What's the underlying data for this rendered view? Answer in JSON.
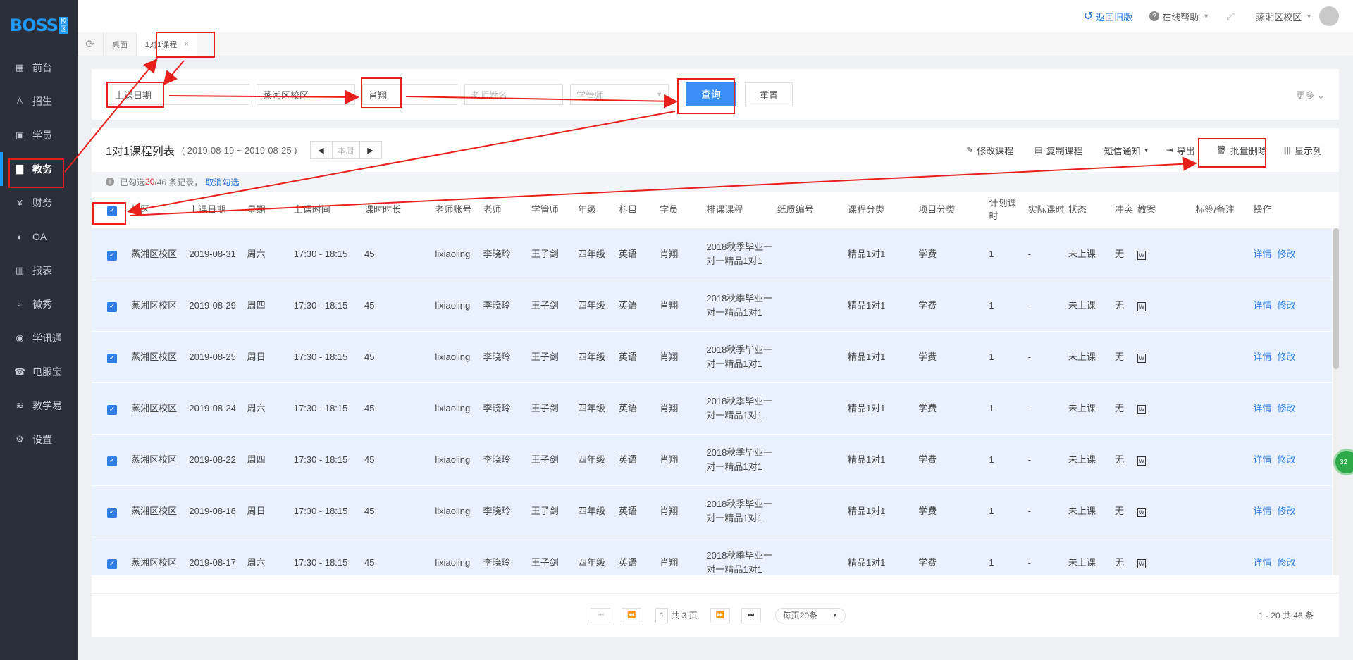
{
  "logo": {
    "text": "BOSS",
    "badge": "校区"
  },
  "sidebar": {
    "items": [
      {
        "label": "前台",
        "icon": "calendar-icon"
      },
      {
        "label": "招生",
        "icon": "user-plus-icon"
      },
      {
        "label": "学员",
        "icon": "student-icon"
      },
      {
        "label": "教务",
        "icon": "book-icon",
        "active": true
      },
      {
        "label": "财务",
        "icon": "yen-icon"
      },
      {
        "label": "OA",
        "icon": "toggle-icon"
      },
      {
        "label": "报表",
        "icon": "bar-chart-icon"
      },
      {
        "label": "微秀",
        "icon": "wave-icon"
      },
      {
        "label": "学讯通",
        "icon": "location-icon"
      },
      {
        "label": "电服宝",
        "icon": "phone-icon"
      },
      {
        "label": "教学易",
        "icon": "teach-icon"
      },
      {
        "label": "设置",
        "icon": "gear-icon"
      }
    ]
  },
  "topbar": {
    "back_old": "返回旧版",
    "help": "在线帮助",
    "campus": "蒸湘区校区"
  },
  "tabs": {
    "home": "桌面",
    "current": "1对1课程",
    "close": "×"
  },
  "filter": {
    "date_placeholder": "上课日期",
    "campus": "蒸湘区校区",
    "student": "肖翔",
    "teacher_placeholder": "老师姓名",
    "manager_placeholder": "学管师",
    "query": "查询",
    "reset": "重置",
    "more": "更多"
  },
  "list": {
    "title": "1对1课程列表",
    "date_range": "( 2019-08-19 ~ 2019-08-25 )",
    "this_week": "本周",
    "tools": {
      "edit": "修改课程",
      "copy": "复制课程",
      "sms": "短信通知",
      "export": "导出",
      "batch_delete": "批量删除",
      "columns": "显示列"
    },
    "info": {
      "prefix": "已勾选 ",
      "selected": "20",
      "suffix": "/46 条记录，",
      "cancel": "取消勾选"
    }
  },
  "table": {
    "headers": [
      "校区",
      "上课日期",
      "星期",
      "上课时间",
      "课时时长",
      "老师账号",
      "老师",
      "学管师",
      "年级",
      "科目",
      "学员",
      "排课课程",
      "纸质编号",
      "课程分类",
      "项目分类",
      "计划课时",
      "实际课时",
      "状态",
      "冲突",
      "教案",
      "标签/备注",
      "操作"
    ],
    "rows": [
      {
        "campus": "蒸湘区校区",
        "date": "2019-08-31",
        "weekday": "周六",
        "time": "17:30 - 18:15",
        "duration": "45",
        "account": "lixiaoling",
        "teacher": "李晓玲",
        "manager": "王子剑",
        "grade": "四年级",
        "subject": "英语",
        "student": "肖翔",
        "course": "2018秋季毕业一对一精品1对1",
        "paper": "",
        "category": "精品1对1",
        "project": "学费",
        "planned": "1",
        "actual": "-",
        "status": "未上课",
        "conflict": "无"
      },
      {
        "campus": "蒸湘区校区",
        "date": "2019-08-29",
        "weekday": "周四",
        "time": "17:30 - 18:15",
        "duration": "45",
        "account": "lixiaoling",
        "teacher": "李晓玲",
        "manager": "王子剑",
        "grade": "四年级",
        "subject": "英语",
        "student": "肖翔",
        "course": "2018秋季毕业一对一精品1对1",
        "paper": "",
        "category": "精品1对1",
        "project": "学费",
        "planned": "1",
        "actual": "-",
        "status": "未上课",
        "conflict": "无"
      },
      {
        "campus": "蒸湘区校区",
        "date": "2019-08-25",
        "weekday": "周日",
        "time": "17:30 - 18:15",
        "duration": "45",
        "account": "lixiaoling",
        "teacher": "李晓玲",
        "manager": "王子剑",
        "grade": "四年级",
        "subject": "英语",
        "student": "肖翔",
        "course": "2018秋季毕业一对一精品1对1",
        "paper": "",
        "category": "精品1对1",
        "project": "学费",
        "planned": "1",
        "actual": "-",
        "status": "未上课",
        "conflict": "无"
      },
      {
        "campus": "蒸湘区校区",
        "date": "2019-08-24",
        "weekday": "周六",
        "time": "17:30 - 18:15",
        "duration": "45",
        "account": "lixiaoling",
        "teacher": "李晓玲",
        "manager": "王子剑",
        "grade": "四年级",
        "subject": "英语",
        "student": "肖翔",
        "course": "2018秋季毕业一对一精品1对1",
        "paper": "",
        "category": "精品1对1",
        "project": "学费",
        "planned": "1",
        "actual": "-",
        "status": "未上课",
        "conflict": "无"
      },
      {
        "campus": "蒸湘区校区",
        "date": "2019-08-22",
        "weekday": "周四",
        "time": "17:30 - 18:15",
        "duration": "45",
        "account": "lixiaoling",
        "teacher": "李晓玲",
        "manager": "王子剑",
        "grade": "四年级",
        "subject": "英语",
        "student": "肖翔",
        "course": "2018秋季毕业一对一精品1对1",
        "paper": "",
        "category": "精品1对1",
        "project": "学费",
        "planned": "1",
        "actual": "-",
        "status": "未上课",
        "conflict": "无"
      },
      {
        "campus": "蒸湘区校区",
        "date": "2019-08-18",
        "weekday": "周日",
        "time": "17:30 - 18:15",
        "duration": "45",
        "account": "lixiaoling",
        "teacher": "李晓玲",
        "manager": "王子剑",
        "grade": "四年级",
        "subject": "英语",
        "student": "肖翔",
        "course": "2018秋季毕业一对一精品1对1",
        "paper": "",
        "category": "精品1对1",
        "project": "学费",
        "planned": "1",
        "actual": "-",
        "status": "未上课",
        "conflict": "无"
      },
      {
        "campus": "蒸湘区校区",
        "date": "2019-08-17",
        "weekday": "周六",
        "time": "17:30 - 18:15",
        "duration": "45",
        "account": "lixiaoling",
        "teacher": "李晓玲",
        "manager": "王子剑",
        "grade": "四年级",
        "subject": "英语",
        "student": "肖翔",
        "course": "2018秋季毕业一对一精品1对1",
        "paper": "",
        "category": "精品1对1",
        "project": "学费",
        "planned": "1",
        "actual": "-",
        "status": "未上课",
        "conflict": "无"
      }
    ],
    "ops": {
      "detail": "详情",
      "edit": "修改"
    }
  },
  "pager": {
    "page": "1",
    "total_pages": "共 3 页",
    "page_size": "每页20条",
    "summary": "1 - 20    共 46 条"
  },
  "float_badge": "32",
  "annotation_color": "#e8201c",
  "accent_color": "#3a8ef6"
}
